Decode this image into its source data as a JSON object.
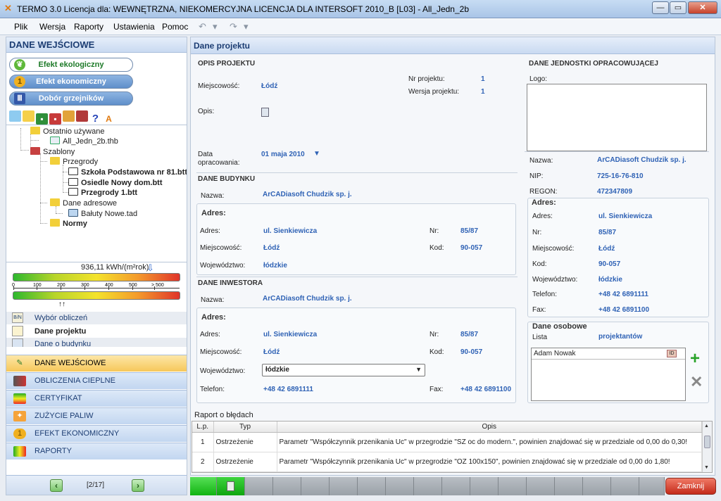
{
  "window": {
    "title": "TERMO 3.0 Licencja dla: WEWNĘTRZNA, NIEKOMERCYJNA LICENCJA DLA INTERSOFT 2010_B [L03] - All_Jedn_2b",
    "minimize": "—",
    "maximize": "▭",
    "close": "✕"
  },
  "menu": {
    "items": [
      "Plik",
      "Wersja",
      "Raporty",
      "Ustawienia",
      "Pomoc"
    ]
  },
  "left": {
    "header": "DANE WEJŚCIOWE",
    "modules": [
      "Efekt ekologiczny",
      "Efekt ekonomiczny",
      "Dobór grzejników"
    ],
    "tree": {
      "recent": "Ostatnio używane",
      "recent_file": "All_Jedn_2b.thb",
      "templates": "Szablony",
      "partitions": "Przegrody",
      "file1": "Szkoła Podstawowa nr 81.btt",
      "file2": "Osiedle Nowy dom.btt",
      "file3": "Przegrody 1.btt",
      "address_data": "Dane adresowe",
      "file4": "Bałuty Nowe.tad",
      "norms": "Normy"
    },
    "energy": {
      "value_text": "936,11 kWh/(m²rok)",
      "ticks": [
        "0",
        "100",
        "200",
        "300",
        "400",
        "500",
        "> 500"
      ]
    },
    "nav_items": [
      "Wybór obliczeń",
      "Dane projektu",
      "Dane o budynku"
    ],
    "sections": [
      "DANE WEJŚCIOWE",
      "OBLICZENIA CIEPLNE",
      "CERTYFIKAT",
      "ZUŻYCIE PALIW",
      "EFEKT EKONOMICZNY",
      "RAPORTY"
    ],
    "pager": {
      "prev": "‹",
      "next": "›",
      "info": "[2/17]"
    }
  },
  "right": {
    "header": "Dane projektu",
    "opis": {
      "title": "OPIS PROJEKTU",
      "miejscowosc_label": "Miejscowość:",
      "miejscowosc": "Łódź",
      "nr_label": "Nr projektu:",
      "nr": "1",
      "wersja_label": "Wersja projektu:",
      "wersja": "1",
      "opis_label": "Opis:",
      "data_label1": "Data",
      "data_label2": "opracowania:",
      "data": "01  maja  2010"
    },
    "budynek": {
      "title": "DANE BUDYNKU",
      "nazwa_label": "Nazwa:",
      "nazwa": "ArCADiasoft Chudzik sp. j.",
      "adres_title": "Adres:",
      "adres_label": "Adres:",
      "adres": "ul. Sienkiewicza",
      "nr_label": "Nr:",
      "nr": "85/87",
      "miejscowosc_label": "Miejscowość:",
      "miejscowosc": "Łódź",
      "kod_label": "Kod:",
      "kod": "90-057",
      "woj_label": "Województwo:",
      "woj": "łódzkie"
    },
    "inwestor": {
      "title": "DANE INWESTORA",
      "nazwa_label": "Nazwa:",
      "nazwa": "ArCADiasoft Chudzik sp. j.",
      "adres_title": "Adres:",
      "adres_label": "Adres:",
      "adres": "ul. Sienkiewicza",
      "nr_label": "Nr:",
      "nr": "85/87",
      "miejscowosc_label": "Miejscowość:",
      "miejscowosc": "Łódź",
      "kod_label": "Kod:",
      "kod": "90-057",
      "woj_label": "Województwo:",
      "woj": "łódzkie",
      "tel_label": "Telefon:",
      "tel": "+48 42 6891111",
      "fax_label": "Fax:",
      "fax": "+48 42 6891100"
    },
    "jednostka": {
      "title": "DANE JEDNOSTKI OPRACOWUJĄCEJ",
      "logo_label": "Logo:",
      "nazwa_label": "Nazwa:",
      "nazwa": "ArCADiasoft Chudzik sp. j.",
      "nip_label": "NIP:",
      "nip": "725-16-76-810",
      "regon_label": "REGON:",
      "regon": "472347809",
      "adres_title": "Adres:",
      "adres_label": "Adres:",
      "adres": "ul. Sienkiewicza",
      "nr_label": "Nr:",
      "nr": "85/87",
      "miejscowosc_label": "Miejscowość:",
      "miejscowosc": "Łódź",
      "kod_label": "Kod:",
      "kod": "90-057",
      "woj_label": "Województwo:",
      "woj": "łódzkie",
      "tel_label": "Telefon:",
      "tel": "+48 42 6891111",
      "fax_label": "Fax:",
      "fax": "+48 42 6891100"
    },
    "osobowe": {
      "title": "Dane osobowe",
      "lista_label": "Lista",
      "lista": "projektantów",
      "person": "Adam Nowak"
    }
  },
  "errors": {
    "title": "Raport o błędach",
    "columns": [
      "L.p.",
      "Typ",
      "Opis"
    ],
    "rows": [
      {
        "lp": "1",
        "typ": "Ostrzeżenie",
        "opis": "Parametr \"Współczynnik przenikania Uc\" w przegrodzie \"SZ oc do modern.\", powinien znajdować się w przedziale od 0,00 do 0,30!"
      },
      {
        "lp": "2",
        "typ": "Ostrzeżenie",
        "opis": "Parametr \"Współczynnik przenikania Uc\" w przegrodzie \"OZ 100x150\", powinien znajdować się w przedziale od 0,00 do 1,80!"
      }
    ]
  },
  "bottom": {
    "close_label": "Zamknij"
  }
}
